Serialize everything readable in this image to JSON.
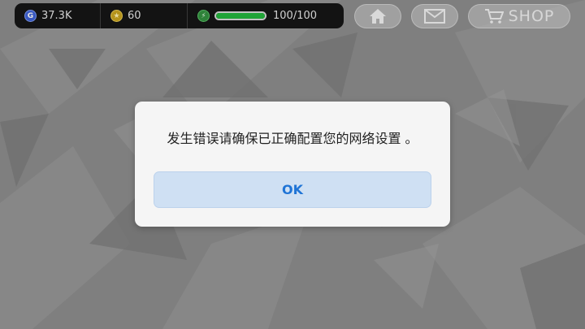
{
  "hud": {
    "gems": {
      "icon": "gem-icon",
      "letter": "G",
      "value": "37.3K"
    },
    "coins": {
      "icon": "star-coin-icon",
      "letter": "★",
      "value": "60"
    },
    "energy": {
      "icon": "lightning-icon",
      "letter": "⚡",
      "value": "100/100",
      "fill_fraction": 1.0
    }
  },
  "nav": {
    "home_icon": "home-icon",
    "mail_icon": "mail-icon",
    "shop_icon": "cart-icon",
    "shop_label": "SHOP"
  },
  "dialog": {
    "message": "发生错误请确保已正确配置您的网络设置 。",
    "ok_label": "OK"
  },
  "colors": {
    "ok_text": "#1f74d6",
    "ok_bg": "#cfe0f3",
    "energy_fill": "#1fb53a"
  }
}
